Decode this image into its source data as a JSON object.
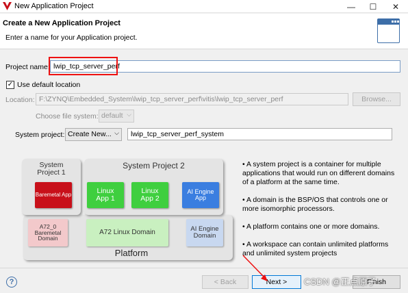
{
  "window": {
    "title": "New Application Project"
  },
  "header": {
    "title": "Create a New Application Project",
    "message": "Enter a name for your Application project."
  },
  "form": {
    "project_name_label": "Project name:",
    "project_name_value": "lwip_tcp_server_perf",
    "use_default_location_label": "Use default location",
    "use_default_location_checked": true,
    "location_label": "Location:",
    "location_value": "F:\\ZYNQ\\Embedded_System\\lwip_tcp_server_perf\\vitis\\lwip_tcp_server_perf",
    "browse_label": "Browse...",
    "file_system_label": "Choose file system:",
    "file_system_value": "default",
    "system_project_label": "System project:",
    "system_project_combo": "Create New...",
    "system_project_value": "lwip_tcp_server_perf_system"
  },
  "diagram": {
    "system_project_1": "System Project 1",
    "system_project_2": "System Project 2",
    "baremetal_app": "Baremetal App",
    "linux_app_1": "Linux App 1",
    "linux_app_2": "Linux App 2",
    "ai_engine_app": "AI Engine App",
    "a72_baremetal_domain": "A72_0 Baremetal Domain",
    "a72_linux_domain": "A72 Linux Domain",
    "ai_engine_domain": "AI Engine Domain",
    "platform": "Platform",
    "colors": {
      "baremetal": "#c8101a",
      "linux": "#3fcf3f",
      "ai_engine": "#3a7ee0"
    }
  },
  "bullets": [
    "• A system project is a container for multiple applications that would run on different domains of a platform at the same time.",
    "• A domain is the BSP/OS that controls one or more isomorphic processors.",
    "• A platform contains one or more domains.",
    "• A workspace can contain unlimited platforms and unlimited system projects"
  ],
  "footer": {
    "back_label": "< Back",
    "next_label": "Next >",
    "finish_label": "Finish"
  },
  "watermark": "CSDN @正点原子",
  "icons": {
    "help": "?"
  }
}
